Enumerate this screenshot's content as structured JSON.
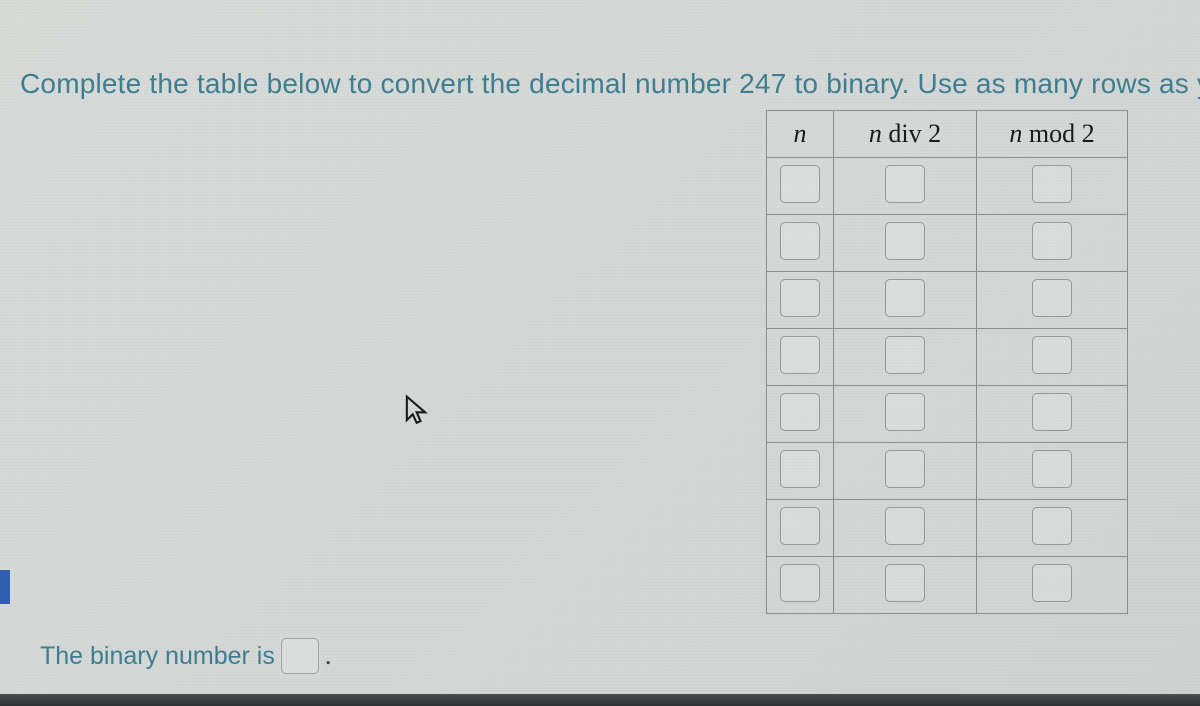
{
  "question_html": "Complete the table below to convert the decimal number 247 to binary. Use as many rows as you need.",
  "decimal_number": "247",
  "table": {
    "headers": {
      "n": "n",
      "div": "n div 2",
      "mod": "n mod 2"
    },
    "row_count": 8
  },
  "answer": {
    "prefix": "The binary number is",
    "value": "",
    "suffix": "."
  }
}
